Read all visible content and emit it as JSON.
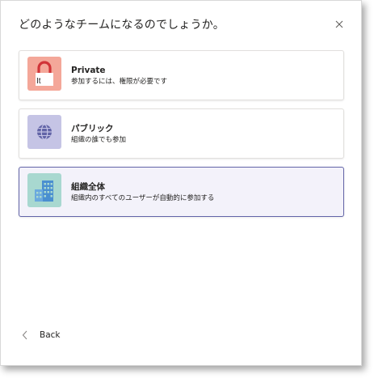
{
  "dialog": {
    "title": "どのようなチームになるのでしょうか。",
    "close_icon": "close-icon"
  },
  "options": [
    {
      "title": "Private",
      "description": "参加するには、権限が必要です",
      "icon": "lock-icon",
      "icon_bg": "#f4a799",
      "selected": false
    },
    {
      "title": "パブリック",
      "description": "組織の誰でも参加",
      "icon": "globe-icon",
      "icon_bg": "#c5c4e5",
      "selected": false
    },
    {
      "title": "組織全体",
      "description": "組織内のすべてのユーザーが自動的に参加する",
      "icon": "building-icon",
      "icon_bg": "#a8d8d0",
      "selected": true
    }
  ],
  "footer": {
    "back_label": "Back",
    "back_icon": "chevron-left-icon"
  },
  "colors": {
    "accent": "#6264a7",
    "selected_bg": "#f3f2fa"
  }
}
